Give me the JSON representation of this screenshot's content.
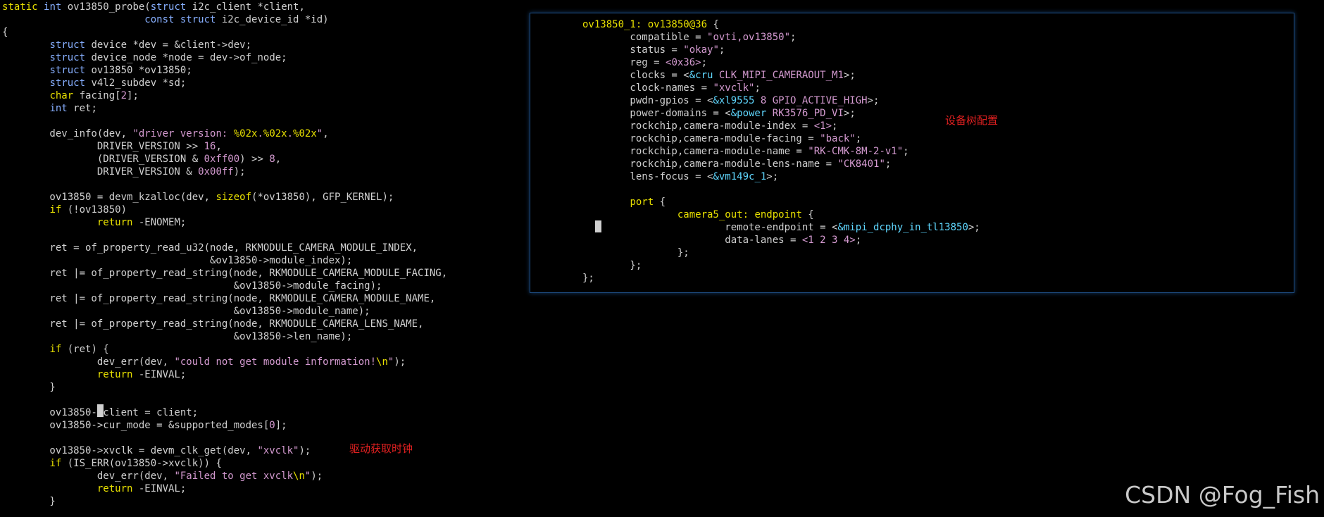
{
  "left_panel": {
    "lines": [
      [
        [
          "static ",
          "kw"
        ],
        [
          "int ",
          "ty"
        ],
        [
          "ov13850_probe(",
          ""
        ],
        [
          "struct ",
          "ty"
        ],
        [
          "i2c_client *client,",
          ""
        ]
      ],
      [
        [
          "                        ",
          ""
        ],
        [
          "const struct ",
          "ty"
        ],
        [
          "i2c_device_id *id)",
          ""
        ]
      ],
      [
        [
          "{",
          ""
        ]
      ],
      [
        [
          "        ",
          ""
        ],
        [
          "struct ",
          "ty"
        ],
        [
          "device *dev = &client->dev;",
          ""
        ]
      ],
      [
        [
          "        ",
          ""
        ],
        [
          "struct ",
          "ty"
        ],
        [
          "device_node *node = dev->of_node;",
          ""
        ]
      ],
      [
        [
          "        ",
          ""
        ],
        [
          "struct ",
          "ty"
        ],
        [
          "ov13850 *ov13850;",
          ""
        ]
      ],
      [
        [
          "        ",
          ""
        ],
        [
          "struct ",
          "ty"
        ],
        [
          "v4l2_subdev *sd;",
          ""
        ]
      ],
      [
        [
          "        ",
          ""
        ],
        [
          "char ",
          "kw"
        ],
        [
          "facing[",
          ""
        ],
        [
          "2",
          "st"
        ],
        [
          "];",
          ""
        ]
      ],
      [
        [
          "        ",
          ""
        ],
        [
          "int ",
          "ty"
        ],
        [
          "ret;",
          ""
        ]
      ],
      [
        [
          "",
          ""
        ]
      ],
      [
        [
          "        dev_info(dev, ",
          ""
        ],
        [
          "\"driver version: ",
          "st"
        ],
        [
          "%02x",
          "kw"
        ],
        [
          ".",
          "st"
        ],
        [
          "%02x",
          "kw"
        ],
        [
          ".",
          "st"
        ],
        [
          "%02x",
          "kw"
        ],
        [
          "\"",
          "st"
        ],
        [
          ",",
          ""
        ]
      ],
      [
        [
          "                DRIVER_VERSION >> ",
          ""
        ],
        [
          "16",
          "st"
        ],
        [
          ",",
          ""
        ]
      ],
      [
        [
          "                (DRIVER_VERSION & ",
          ""
        ],
        [
          "0xff00",
          "st"
        ],
        [
          ") >> ",
          ""
        ],
        [
          "8",
          "st"
        ],
        [
          ",",
          ""
        ]
      ],
      [
        [
          "                DRIVER_VERSION & ",
          ""
        ],
        [
          "0x00ff",
          "st"
        ],
        [
          ");",
          ""
        ]
      ],
      [
        [
          "",
          ""
        ]
      ],
      [
        [
          "        ov13850 = devm_kzalloc(dev, ",
          ""
        ],
        [
          "sizeof",
          "kw"
        ],
        [
          "(*ov13850), GFP_KERNEL);",
          ""
        ]
      ],
      [
        [
          "        ",
          ""
        ],
        [
          "if ",
          "kw"
        ],
        [
          "(!ov13850)",
          ""
        ]
      ],
      [
        [
          "                ",
          ""
        ],
        [
          "return ",
          "kw"
        ],
        [
          "-ENOMEM;",
          ""
        ]
      ],
      [
        [
          "",
          ""
        ]
      ],
      [
        [
          "        ret = of_property_read_u32(node, RKMODULE_CAMERA_MODULE_INDEX,",
          ""
        ]
      ],
      [
        [
          "                                   &ov13850->module_index);",
          ""
        ]
      ],
      [
        [
          "        ret |= of_property_read_string(node, RKMODULE_CAMERA_MODULE_FACING,",
          ""
        ]
      ],
      [
        [
          "                                       &ov13850->module_facing);",
          ""
        ]
      ],
      [
        [
          "        ret |= of_property_read_string(node, RKMODULE_CAMERA_MODULE_NAME,",
          ""
        ]
      ],
      [
        [
          "                                       &ov13850->module_name);",
          ""
        ]
      ],
      [
        [
          "        ret |= of_property_read_string(node, RKMODULE_CAMERA_LENS_NAME,",
          ""
        ]
      ],
      [
        [
          "                                       &ov13850->len_name);",
          ""
        ]
      ],
      [
        [
          "        ",
          ""
        ],
        [
          "if ",
          "kw"
        ],
        [
          "(ret) {",
          ""
        ]
      ],
      [
        [
          "                dev_err(dev, ",
          ""
        ],
        [
          "\"could not get module information!",
          "st"
        ],
        [
          "\\n",
          "kw"
        ],
        [
          "\"",
          "st"
        ],
        [
          ");",
          ""
        ]
      ],
      [
        [
          "                ",
          ""
        ],
        [
          "return ",
          "kw"
        ],
        [
          "-EINVAL;",
          ""
        ]
      ],
      [
        [
          "        }",
          ""
        ]
      ],
      [
        [
          "",
          ""
        ]
      ],
      [
        [
          "        ov13850->client = client;",
          ""
        ]
      ],
      [
        [
          "        ov13850->cur_mode = &supported_modes[",
          ""
        ],
        [
          "0",
          "st"
        ],
        [
          "];",
          ""
        ]
      ],
      [
        [
          "",
          ""
        ]
      ],
      [
        [
          "        ov13850->xvclk = devm_clk_get(dev, ",
          ""
        ],
        [
          "\"xvclk\"",
          "st"
        ],
        [
          ");",
          ""
        ]
      ],
      [
        [
          "        ",
          ""
        ],
        [
          "if ",
          "kw"
        ],
        [
          "(IS_ERR(ov13850->xvclk)) {",
          ""
        ]
      ],
      [
        [
          "                dev_err(dev, ",
          ""
        ],
        [
          "\"Failed to get xvclk",
          "st"
        ],
        [
          "\\n",
          "kw"
        ],
        [
          "\"",
          "st"
        ],
        [
          ");",
          ""
        ]
      ],
      [
        [
          "                ",
          ""
        ],
        [
          "return ",
          "kw"
        ],
        [
          "-EINVAL;",
          ""
        ]
      ],
      [
        [
          "        }",
          ""
        ]
      ]
    ],
    "annotation": "驱动获取时钟"
  },
  "right_panel": {
    "lines": [
      [
        [
          "ov13850_1: ",
          "lb"
        ],
        [
          "ov13850@36 ",
          "lb"
        ],
        [
          "{",
          ""
        ]
      ],
      [
        [
          "        compatible = ",
          ""
        ],
        [
          "\"ovti,ov13850\"",
          "st"
        ],
        [
          ";",
          ""
        ]
      ],
      [
        [
          "        status = ",
          ""
        ],
        [
          "\"okay\"",
          "st"
        ],
        [
          ";",
          ""
        ]
      ],
      [
        [
          "        reg = ",
          ""
        ],
        [
          "<0x36>",
          "st"
        ],
        [
          ";",
          ""
        ]
      ],
      [
        [
          "        clocks = <",
          ""
        ],
        [
          "&cru ",
          "rf"
        ],
        [
          "CLK_MIPI_CAMERAOUT_M1",
          "st"
        ],
        [
          ">;",
          ""
        ]
      ],
      [
        [
          "        clock-names = ",
          ""
        ],
        [
          "\"xvclk\"",
          "st"
        ],
        [
          ";",
          ""
        ]
      ],
      [
        [
          "        pwdn-gpios = <",
          ""
        ],
        [
          "&xl9555 ",
          "rf"
        ],
        [
          "8 GPIO_ACTIVE_HIGH",
          "st"
        ],
        [
          ">;",
          ""
        ]
      ],
      [
        [
          "        power-domains = <",
          ""
        ],
        [
          "&power ",
          "rf"
        ],
        [
          "RK3576_PD_VI",
          "st"
        ],
        [
          ">;",
          ""
        ]
      ],
      [
        [
          "        rockchip,camera-module-index = ",
          ""
        ],
        [
          "<1>",
          "st"
        ],
        [
          ";",
          ""
        ]
      ],
      [
        [
          "        rockchip,camera-module-facing = ",
          ""
        ],
        [
          "\"back\"",
          "st"
        ],
        [
          ";",
          ""
        ]
      ],
      [
        [
          "        rockchip,camera-module-name = ",
          ""
        ],
        [
          "\"RK-CMK-8M-2-v1\"",
          "st"
        ],
        [
          ";",
          ""
        ]
      ],
      [
        [
          "        rockchip,camera-module-lens-name = ",
          ""
        ],
        [
          "\"CK8401\"",
          "st"
        ],
        [
          ";",
          ""
        ]
      ],
      [
        [
          "        lens-focus = <",
          ""
        ],
        [
          "&vm149c_1",
          "rf"
        ],
        [
          ">;",
          ""
        ]
      ],
      [
        [
          "",
          ""
        ]
      ],
      [
        [
          "        ",
          ""
        ],
        [
          "port ",
          "lb"
        ],
        [
          "{",
          ""
        ]
      ],
      [
        [
          "                ",
          ""
        ],
        [
          "camera5_out: ",
          "lb"
        ],
        [
          "endpoint ",
          "lb"
        ],
        [
          "{",
          ""
        ]
      ],
      [
        [
          "                        remote-endpoint = <",
          ""
        ],
        [
          "&mipi_dcphy_in_tl13850",
          "rf"
        ],
        [
          ">;",
          ""
        ]
      ],
      [
        [
          "                        data-lanes = ",
          ""
        ],
        [
          "<1 2 3 4>",
          "st"
        ],
        [
          ";",
          ""
        ]
      ],
      [
        [
          "                };",
          ""
        ]
      ],
      [
        [
          "        };",
          ""
        ]
      ],
      [
        [
          "};",
          ""
        ]
      ]
    ],
    "annotation": "设备树配置"
  },
  "watermark": "CSDN @Fog_Fish",
  "colors": {
    "background": "#000000",
    "panel_border": "#1f4f86",
    "keyword": "#e8e000",
    "type": "#87afff",
    "string": "#d49ad0",
    "reference": "#5fd7ff",
    "annotation": "#e02020"
  }
}
